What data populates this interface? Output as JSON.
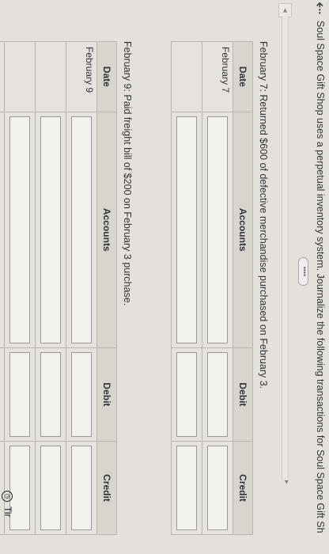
{
  "header": {
    "back_icon": "back-arrow-icon",
    "instruction": "Soul Space Gift Shop uses a perpetual inventory system. Journalize the following transactions for Soul Space Gift Sh",
    "more_label": "••••"
  },
  "navigator": {
    "left_glyph": "◄",
    "right_glyph": "▸"
  },
  "section1": {
    "prompt": "February 7: Returned $600 of defective merchandise purchased on February 3.",
    "columns": {
      "date": "Date",
      "accounts": "Accounts",
      "debit": "Debit",
      "credit": "Credit"
    },
    "rows": [
      {
        "date": "February 7"
      },
      {
        "date": ""
      }
    ]
  },
  "section2": {
    "prompt": "February 9: Paid freight bill of $200 on February 3 purchase.",
    "columns": {
      "date": "Date",
      "accounts": "Accounts",
      "debit": "Debit",
      "credit": "Credit"
    },
    "rows": [
      {
        "date": "February 9"
      },
      {
        "date": ""
      },
      {
        "date": ""
      },
      {
        "date": ""
      }
    ]
  },
  "footer": {
    "time_icon": "clock-icon",
    "time_label": "Tir"
  }
}
